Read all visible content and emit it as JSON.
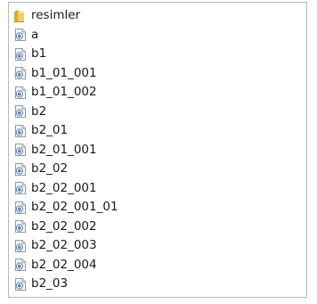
{
  "folder": {
    "name": "resimler",
    "icon": "folder-icon"
  },
  "files": [
    {
      "name": "a",
      "icon": "image-file-icon"
    },
    {
      "name": "b1",
      "icon": "image-file-icon"
    },
    {
      "name": "b1_01_001",
      "icon": "image-file-icon"
    },
    {
      "name": "b1_01_002",
      "icon": "image-file-icon"
    },
    {
      "name": "b2",
      "icon": "image-file-icon"
    },
    {
      "name": "b2_01",
      "icon": "image-file-icon"
    },
    {
      "name": "b2_01_001",
      "icon": "image-file-icon"
    },
    {
      "name": "b2_02",
      "icon": "image-file-icon"
    },
    {
      "name": "b2_02_001",
      "icon": "image-file-icon"
    },
    {
      "name": "b2_02_001_01",
      "icon": "image-file-icon"
    },
    {
      "name": "b2_02_002",
      "icon": "image-file-icon"
    },
    {
      "name": "b2_02_003",
      "icon": "image-file-icon"
    },
    {
      "name": "b2_02_004",
      "icon": "image-file-icon"
    },
    {
      "name": "b2_03",
      "icon": "image-file-icon"
    }
  ],
  "colors": {
    "folder": "#e8c45a",
    "file_border": "#8a9bb0",
    "file_accent": "#4a7fc1"
  }
}
